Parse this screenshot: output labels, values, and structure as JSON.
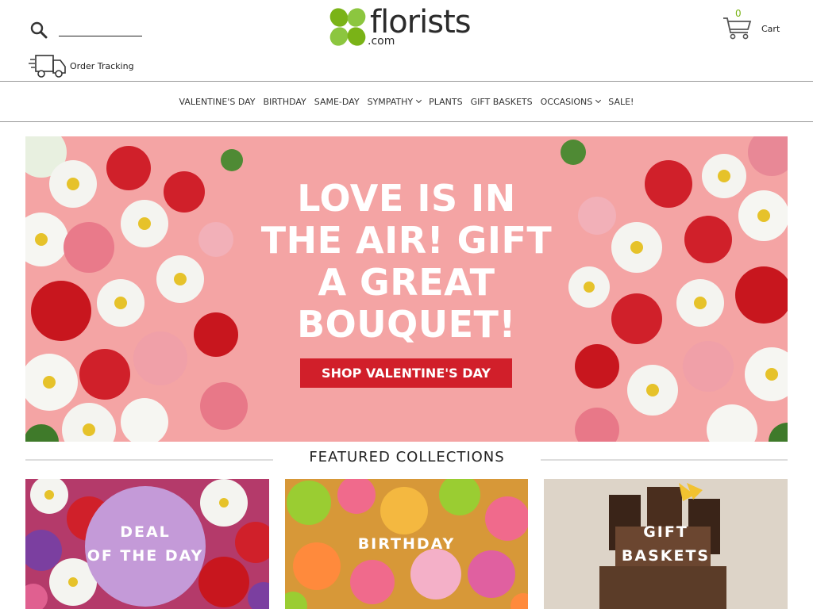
{
  "header": {
    "search_placeholder": "",
    "logo_text": "florists",
    "logo_domain": ".com",
    "order_tracking": "Order Tracking",
    "cart_count": "0",
    "cart_label": "Cart"
  },
  "nav": {
    "items": [
      {
        "label": "VALENTINE'S DAY",
        "has_dropdown": false
      },
      {
        "label": "BIRTHDAY",
        "has_dropdown": false
      },
      {
        "label": "SAME-DAY",
        "has_dropdown": false
      },
      {
        "label": "SYMPATHY",
        "has_dropdown": true
      },
      {
        "label": "PLANTS",
        "has_dropdown": false
      },
      {
        "label": "GIFT BASKETS",
        "has_dropdown": false
      },
      {
        "label": "OCCASIONS",
        "has_dropdown": true
      },
      {
        "label": "SALE!",
        "has_dropdown": false
      }
    ]
  },
  "hero": {
    "lines": [
      "LOVE IS IN",
      "THE AIR! GIFT",
      "A GREAT",
      "BOUQUET!"
    ],
    "button": "SHOP VALENTINE'S DAY",
    "colors": {
      "background": "#f4a4a4",
      "button": "#d11f2a"
    }
  },
  "featured": {
    "title": "FEATURED COLLECTIONS",
    "tiles": [
      {
        "line1": "DEAL",
        "line2": "OF THE DAY"
      },
      {
        "line1": "BIRTHDAY",
        "line2": ""
      },
      {
        "line1": "GIFT",
        "line2": "BASKETS"
      }
    ]
  },
  "colors": {
    "brand_green": "#7ab317",
    "text": "#222222"
  }
}
